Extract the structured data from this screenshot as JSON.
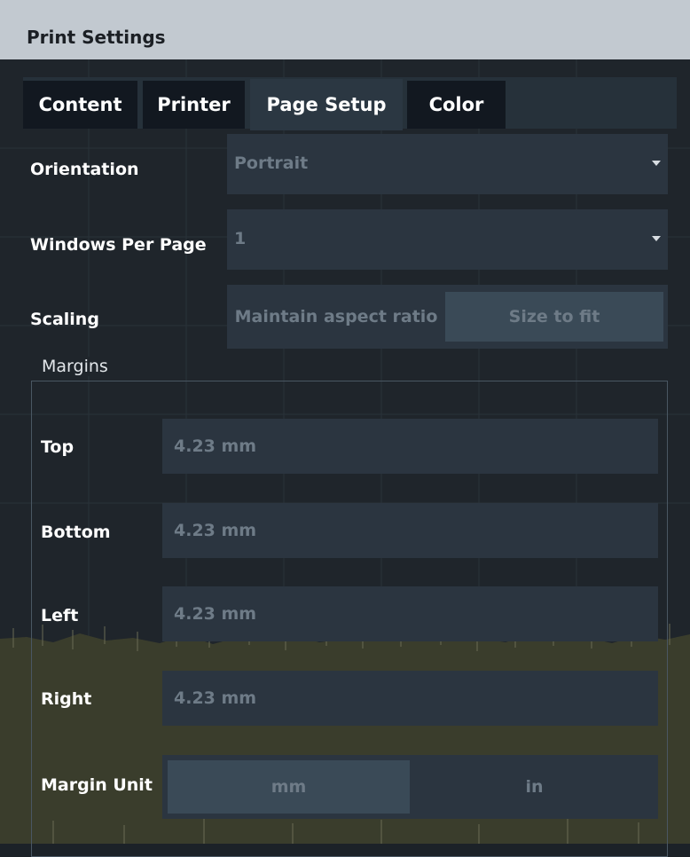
{
  "window": {
    "title": "Print Settings"
  },
  "tabs": [
    {
      "label": "Content",
      "active": false
    },
    {
      "label": "Printer",
      "active": false
    },
    {
      "label": "Page Setup",
      "active": true
    },
    {
      "label": "Color",
      "active": false
    }
  ],
  "orientation": {
    "label": "Orientation",
    "value": "Portrait"
  },
  "windows_per_page": {
    "label": "Windows Per Page",
    "value": "1"
  },
  "scaling": {
    "label": "Scaling",
    "options": [
      "Maintain aspect ratio",
      "Size to fit"
    ],
    "selected": "Size to fit"
  },
  "margins": {
    "legend": "Margins",
    "top": {
      "label": "Top",
      "value": "4.23 mm"
    },
    "bottom": {
      "label": "Bottom",
      "value": "4.23 mm"
    },
    "left": {
      "label": "Left",
      "value": "4.23 mm"
    },
    "right": {
      "label": "Right",
      "value": "4.23 mm"
    },
    "unit": {
      "label": "Margin Unit",
      "options": [
        "mm",
        "in"
      ],
      "selected": "mm"
    }
  },
  "colors": {
    "titlebar": "#c2c9d0",
    "panel": "#1f252b",
    "field": "#2b3540",
    "plot_band": "#3a3d2c"
  }
}
